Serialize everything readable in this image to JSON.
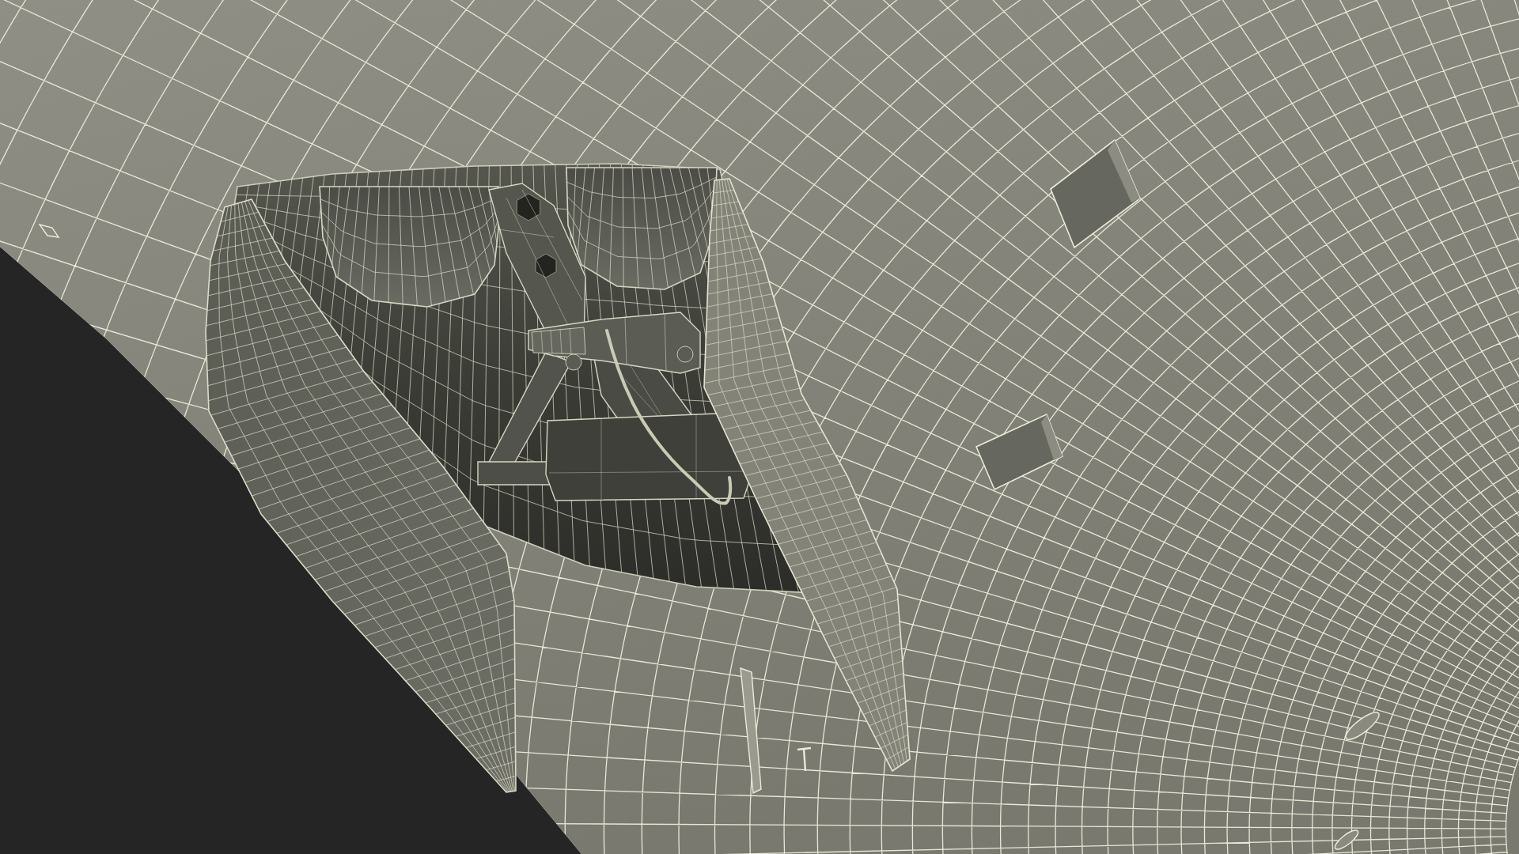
{
  "viewport": {
    "kind": "wireframe"
  }
}
